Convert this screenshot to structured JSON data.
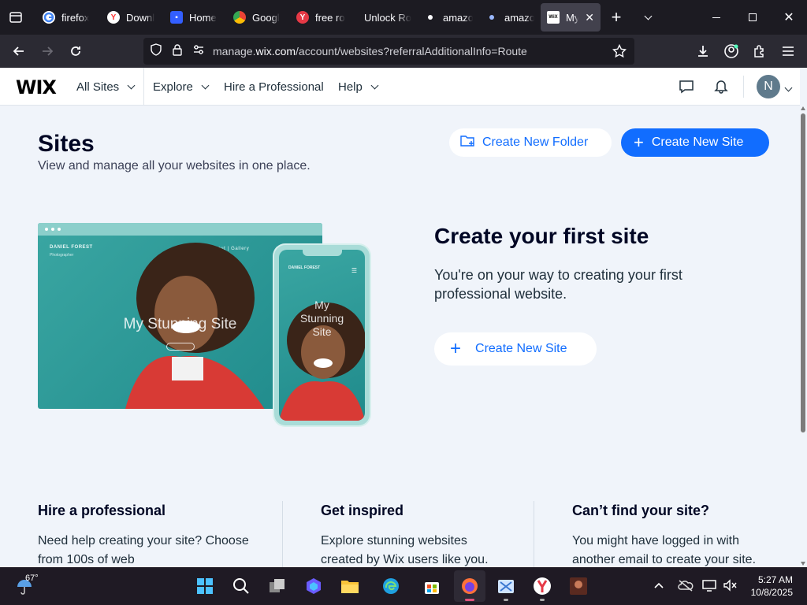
{
  "browser": {
    "tabs": [
      {
        "title": "firefox",
        "icon": "google-icon"
      },
      {
        "title": "Downl",
        "icon": "yandex-icon"
      },
      {
        "title": "Home",
        "icon": "roblox-icon"
      },
      {
        "title": "Googl",
        "icon": "chrome-icon"
      },
      {
        "title": "free ro",
        "icon": "yandex-icon"
      },
      {
        "title": "Unlock Rob",
        "icon": "none"
      },
      {
        "title": "amazo",
        "icon": "dot-icon"
      },
      {
        "title": "amazo",
        "icon": "dot-icon"
      },
      {
        "title": "My",
        "icon": "wix-icon",
        "active": true
      }
    ],
    "url_prefix": "manage.",
    "url_domain": "wix.com",
    "url_path": "/account/websites?referralAdditionalInfo=Route"
  },
  "wix_header": {
    "logo": "WIX",
    "nav": {
      "all_sites": "All Sites",
      "explore": "Explore",
      "hire": "Hire a Professional",
      "help": "Help"
    },
    "avatar_initial": "N"
  },
  "page": {
    "title": "Sites",
    "subtitle": "View and manage all your websites in one place.",
    "create_folder": "Create New Folder",
    "create_site": "Create New Site"
  },
  "illustration": {
    "brand": "DANIEL FOREST",
    "brand_sub": "Photographer",
    "menu": "Home   |   About   |   Gallery",
    "headline": "My Stunning Site",
    "phone_headline_1": "My",
    "phone_headline_2": "Stunning",
    "phone_headline_3": "Site"
  },
  "cta": {
    "title": "Create your first site",
    "subtitle": "You're on your way to creating your first professional website.",
    "button": "Create New Site"
  },
  "columns": [
    {
      "title": "Hire a professional",
      "text": "Need help creating your site? Choose from 100s of web"
    },
    {
      "title": "Get inspired",
      "text": "Explore stunning websites created by Wix users like you."
    },
    {
      "title": "Can’t find your site?",
      "text": "You might have logged in with another email to create your site."
    }
  ],
  "taskbar": {
    "temperature": "67°",
    "time": "5:27 AM",
    "date": "10/8/2025"
  },
  "colors": {
    "accent": "#116dff",
    "page_bg": "#f0f4fa",
    "tabstrip": "#1c1b22",
    "navbar": "#2b2a33"
  }
}
